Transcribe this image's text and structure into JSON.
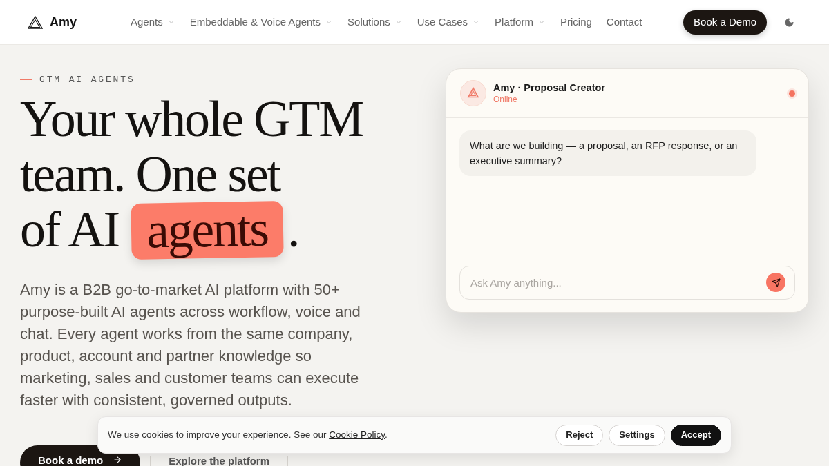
{
  "nav": {
    "brand": "Amy",
    "items": [
      {
        "label": "Agents",
        "has_menu": true
      },
      {
        "label": "Embeddable & Voice Agents",
        "has_menu": true
      },
      {
        "label": "Solutions",
        "has_menu": true
      },
      {
        "label": "Use Cases",
        "has_menu": true
      },
      {
        "label": "Platform",
        "has_menu": true
      },
      {
        "label": "Pricing",
        "has_menu": false
      },
      {
        "label": "Contact",
        "has_menu": false
      }
    ],
    "cta": "Book a Demo"
  },
  "hero": {
    "eyebrow": "GTM AI AGENTS",
    "headline": {
      "lines": [
        "Your whole GTM",
        "team. One set",
        "of AI"
      ],
      "highlight": "agents",
      "end": "."
    },
    "description": "Amy is a B2B go-to-market AI platform with 50+ purpose-built AI agents across workflow, voice and chat. Every agent works from the same company, product, account and partner knowledge so marketing, sales and customer teams can execute faster with consistent, governed outputs.",
    "buttons": [
      {
        "label": "Book a demo",
        "kind": "primary"
      },
      {
        "label": "Explore the platform",
        "kind": "secondary"
      }
    ]
  },
  "chat": {
    "title": "Amy · Proposal Creator",
    "status": "Online",
    "messages": [
      "What are we building — a proposal, an RFP response, or an executive summary?"
    ],
    "input": {
      "placeholder": "Ask Amy anything..."
    }
  },
  "cookie_banner": {
    "text": "We use cookies to improve your experience. See our",
    "link": "Cookie Policy",
    "end": ".",
    "buttons": [
      {
        "label": "Reject",
        "kind": "secondary"
      },
      {
        "label": "Settings",
        "kind": "secondary"
      },
      {
        "label": "Accept",
        "kind": "primary"
      }
    ]
  }
}
